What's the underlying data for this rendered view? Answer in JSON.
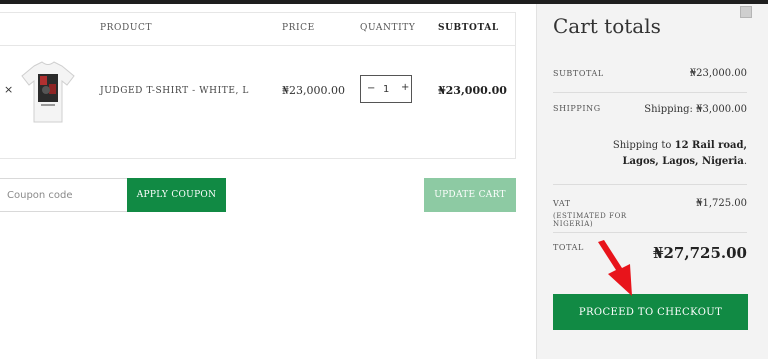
{
  "table": {
    "headers": {
      "product": "PRODUCT",
      "price": "PRICE",
      "quantity": "QUANTITY",
      "subtotal": "SUBTOTAL"
    },
    "rows": [
      {
        "remove": "×",
        "product": "JUDGED T-SHIRT - WHITE, L",
        "price": "₦23,000.00",
        "quantity": "1",
        "subtotal": "₦23,000.00"
      }
    ],
    "qty_minus": "−",
    "qty_plus": "+"
  },
  "coupon": {
    "placeholder": "Coupon code",
    "apply_label": "APPLY COUPON",
    "update_label": "UPDATE CART"
  },
  "totals": {
    "title": "Cart totals",
    "subtotal_label": "SUBTOTAL",
    "subtotal_value": "₦23,000.00",
    "shipping_label": "SHIPPING",
    "shipping_value": "Shipping: ₦3,000.00",
    "shipping_to_prefix": "Shipping to",
    "shipping_address": "12 Rail road, Lagos, Lagos, Nigeria",
    "vat_label": "VAT",
    "vat_note": "(ESTIMATED FOR NIGERIA)",
    "vat_value": "₦1,725.00",
    "total_label": "TOTAL",
    "total_value": "₦27,725.00",
    "checkout_label": "PROCEED TO CHECKOUT"
  },
  "colors": {
    "primary_green": "#118a44",
    "disabled_green": "#8dcaa3",
    "panel_bg": "#f3f3f3",
    "annotation_red": "#e8141b"
  },
  "icons": {
    "remove": "close-icon",
    "product_image": "tshirt-thumbnail",
    "account": "user-icon",
    "annotation": "red-arrow-icon"
  }
}
